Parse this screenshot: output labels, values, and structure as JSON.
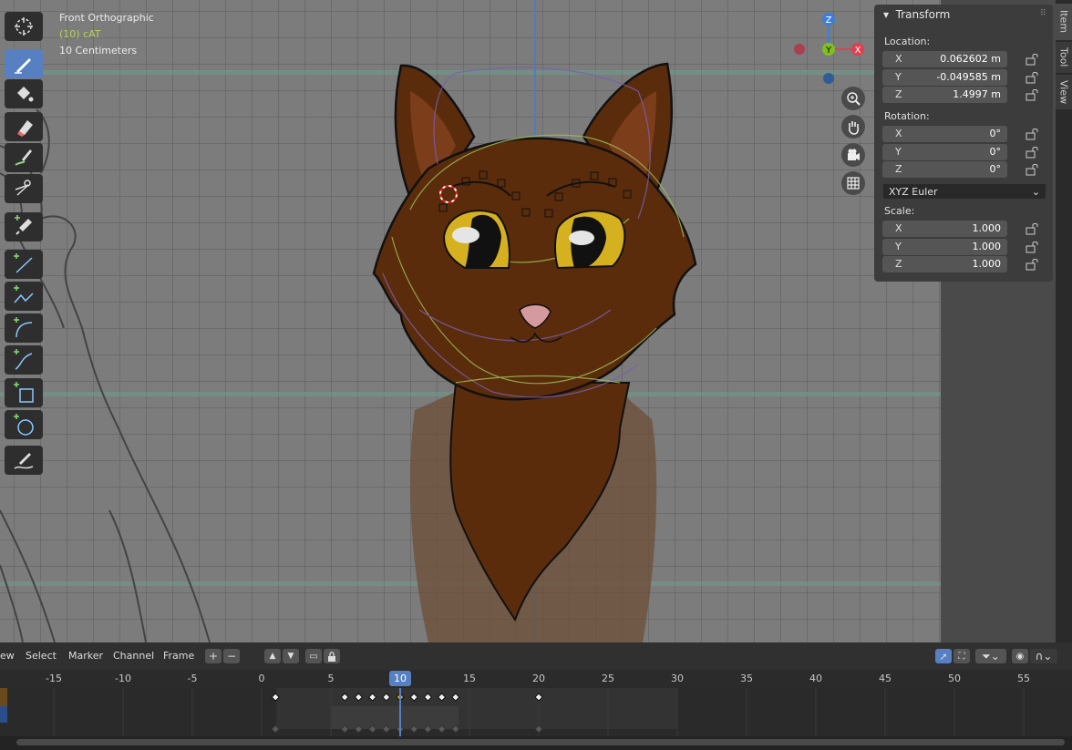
{
  "viewport": {
    "view_name": "Front Orthographic",
    "object_name": "(10) cAT",
    "scale_text": "10 Centimeters"
  },
  "gizmo": {
    "z": "Z",
    "y": "Y",
    "x": "X"
  },
  "sidebar_tabs": [
    "Item",
    "Tool",
    "View"
  ],
  "transform_panel": {
    "title": "Transform",
    "location_label": "Location:",
    "location": [
      {
        "axis": "X",
        "value": "0.062602 m"
      },
      {
        "axis": "Y",
        "value": "-0.049585 m"
      },
      {
        "axis": "Z",
        "value": "1.4997 m"
      }
    ],
    "rotation_label": "Rotation:",
    "rotation": [
      {
        "axis": "X",
        "value": "0°"
      },
      {
        "axis": "Y",
        "value": "0°"
      },
      {
        "axis": "Z",
        "value": "0°"
      }
    ],
    "rotation_mode": "XYZ Euler",
    "scale_label": "Scale:",
    "scale": [
      {
        "axis": "X",
        "value": "1.000"
      },
      {
        "axis": "Y",
        "value": "1.000"
      },
      {
        "axis": "Z",
        "value": "1.000"
      }
    ]
  },
  "timeline": {
    "menus": [
      "ew",
      "Select",
      "Marker",
      "Channel",
      "Frame"
    ],
    "current_frame": "10",
    "ticks": [
      "-15",
      "-10",
      "-5",
      "0",
      "5",
      "10",
      "15",
      "20",
      "25",
      "30",
      "35",
      "40",
      "45",
      "50",
      "55"
    ]
  },
  "colors": {
    "accent": "#5680c2",
    "cat_fur": "#5a2c0c",
    "eye": "#d6b11f",
    "nose": "#d49aa0",
    "axis_x": "#e04050",
    "axis_y": "#7fbf1f",
    "axis_z": "#3a7fd8"
  }
}
